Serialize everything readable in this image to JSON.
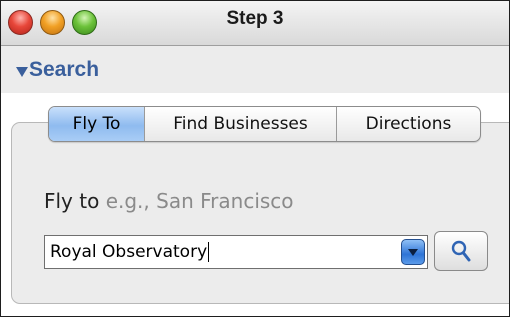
{
  "window": {
    "title": "Step 3",
    "buttons": [
      "close",
      "minimize",
      "zoom"
    ]
  },
  "search": {
    "header": "Search",
    "tabs": [
      {
        "label": "Fly To",
        "active": true
      },
      {
        "label": "Find Businesses",
        "active": false
      },
      {
        "label": "Directions",
        "active": false
      }
    ],
    "fly_label": "Fly to",
    "fly_hint": "e.g., San Francisco",
    "input_value": "Royal Observatory",
    "icons": {
      "dropdown": "chevron-down-icon",
      "search": "magnifier-icon"
    },
    "accent_color": "#3a5f9c",
    "active_tab_color": "#8fbbef"
  }
}
